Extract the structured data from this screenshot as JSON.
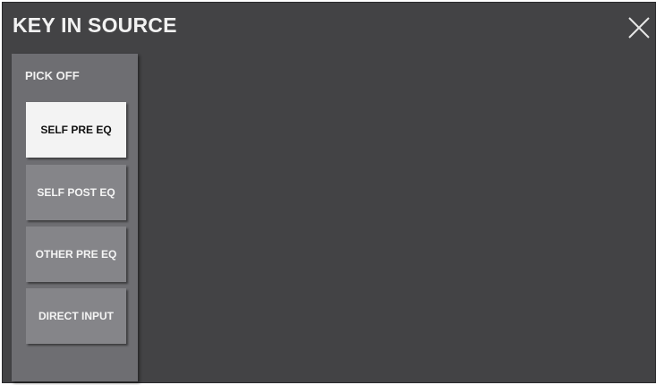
{
  "dialog": {
    "title": "KEY IN SOURCE",
    "close_icon": "close-icon"
  },
  "pick_off": {
    "label": "PICK OFF",
    "options": [
      {
        "label": "SELF PRE EQ",
        "selected": true
      },
      {
        "label": "SELF POST EQ",
        "selected": false
      },
      {
        "label": "OTHER PRE EQ",
        "selected": false
      },
      {
        "label": "DIRECT INPUT",
        "selected": false
      }
    ]
  },
  "colors": {
    "background": "#434345",
    "panel": "#6e6e72",
    "button": "#858589",
    "button_selected": "#f3f3f3"
  }
}
